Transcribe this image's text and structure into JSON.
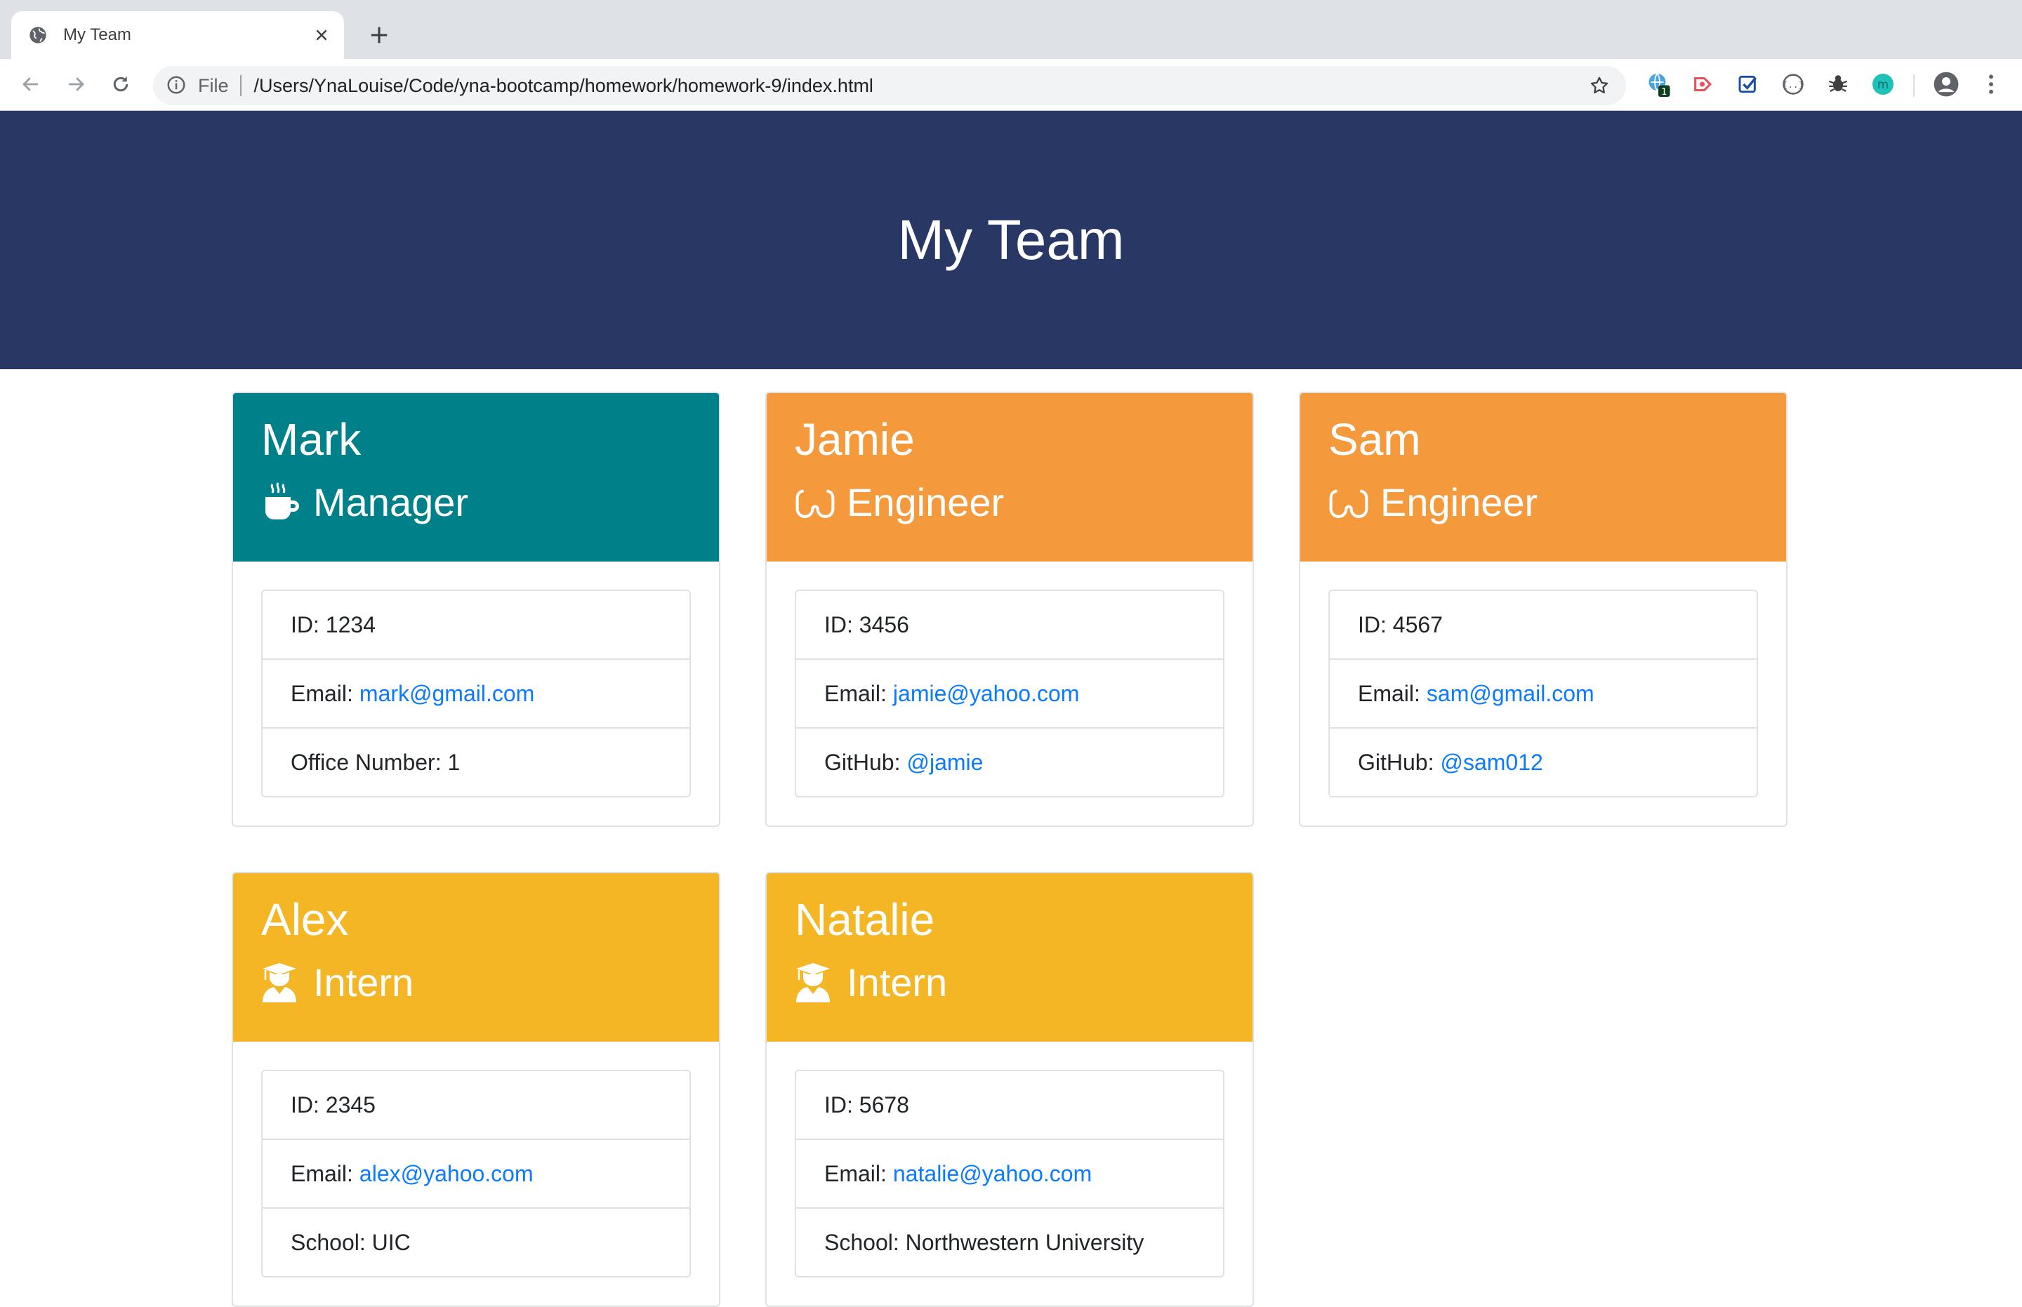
{
  "browser": {
    "tab_title": "My Team",
    "scheme_label": "File",
    "url": "/Users/YnaLouise/Code/yna-bootcamp/homework/homework-9/index.html",
    "extension_badge": "1"
  },
  "page": {
    "title": "My Team"
  },
  "colors": {
    "jumbotron": "#283764",
    "manager": "#008088",
    "engineer": "#f4993c",
    "intern": "#f4b625",
    "link": "#0a7bff"
  },
  "labels": {
    "id": "ID:",
    "email": "Email:",
    "office": "Office Number:",
    "github": "GitHub:",
    "school": "School:"
  },
  "team": [
    {
      "name": "Mark",
      "role": "Manager",
      "icon": "mug-icon",
      "id": "1234",
      "email": "mark@gmail.com",
      "extra_label": "Office Number:",
      "extra_value": "1"
    },
    {
      "name": "Jamie",
      "role": "Engineer",
      "icon": "glasses-icon",
      "id": "3456",
      "email": "jamie@yahoo.com",
      "extra_label": "GitHub:",
      "extra_value": "@jamie"
    },
    {
      "name": "Sam",
      "role": "Engineer",
      "icon": "glasses-icon",
      "id": "4567",
      "email": "sam@gmail.com",
      "extra_label": "GitHub:",
      "extra_value": "@sam012"
    },
    {
      "name": "Alex",
      "role": "Intern",
      "icon": "graduate-icon",
      "id": "2345",
      "email": "alex@yahoo.com",
      "extra_label": "School:",
      "extra_value": "UIC"
    },
    {
      "name": "Natalie",
      "role": "Intern",
      "icon": "graduate-icon",
      "id": "5678",
      "email": "natalie@yahoo.com",
      "extra_label": "School:",
      "extra_value": "Northwestern University"
    }
  ]
}
